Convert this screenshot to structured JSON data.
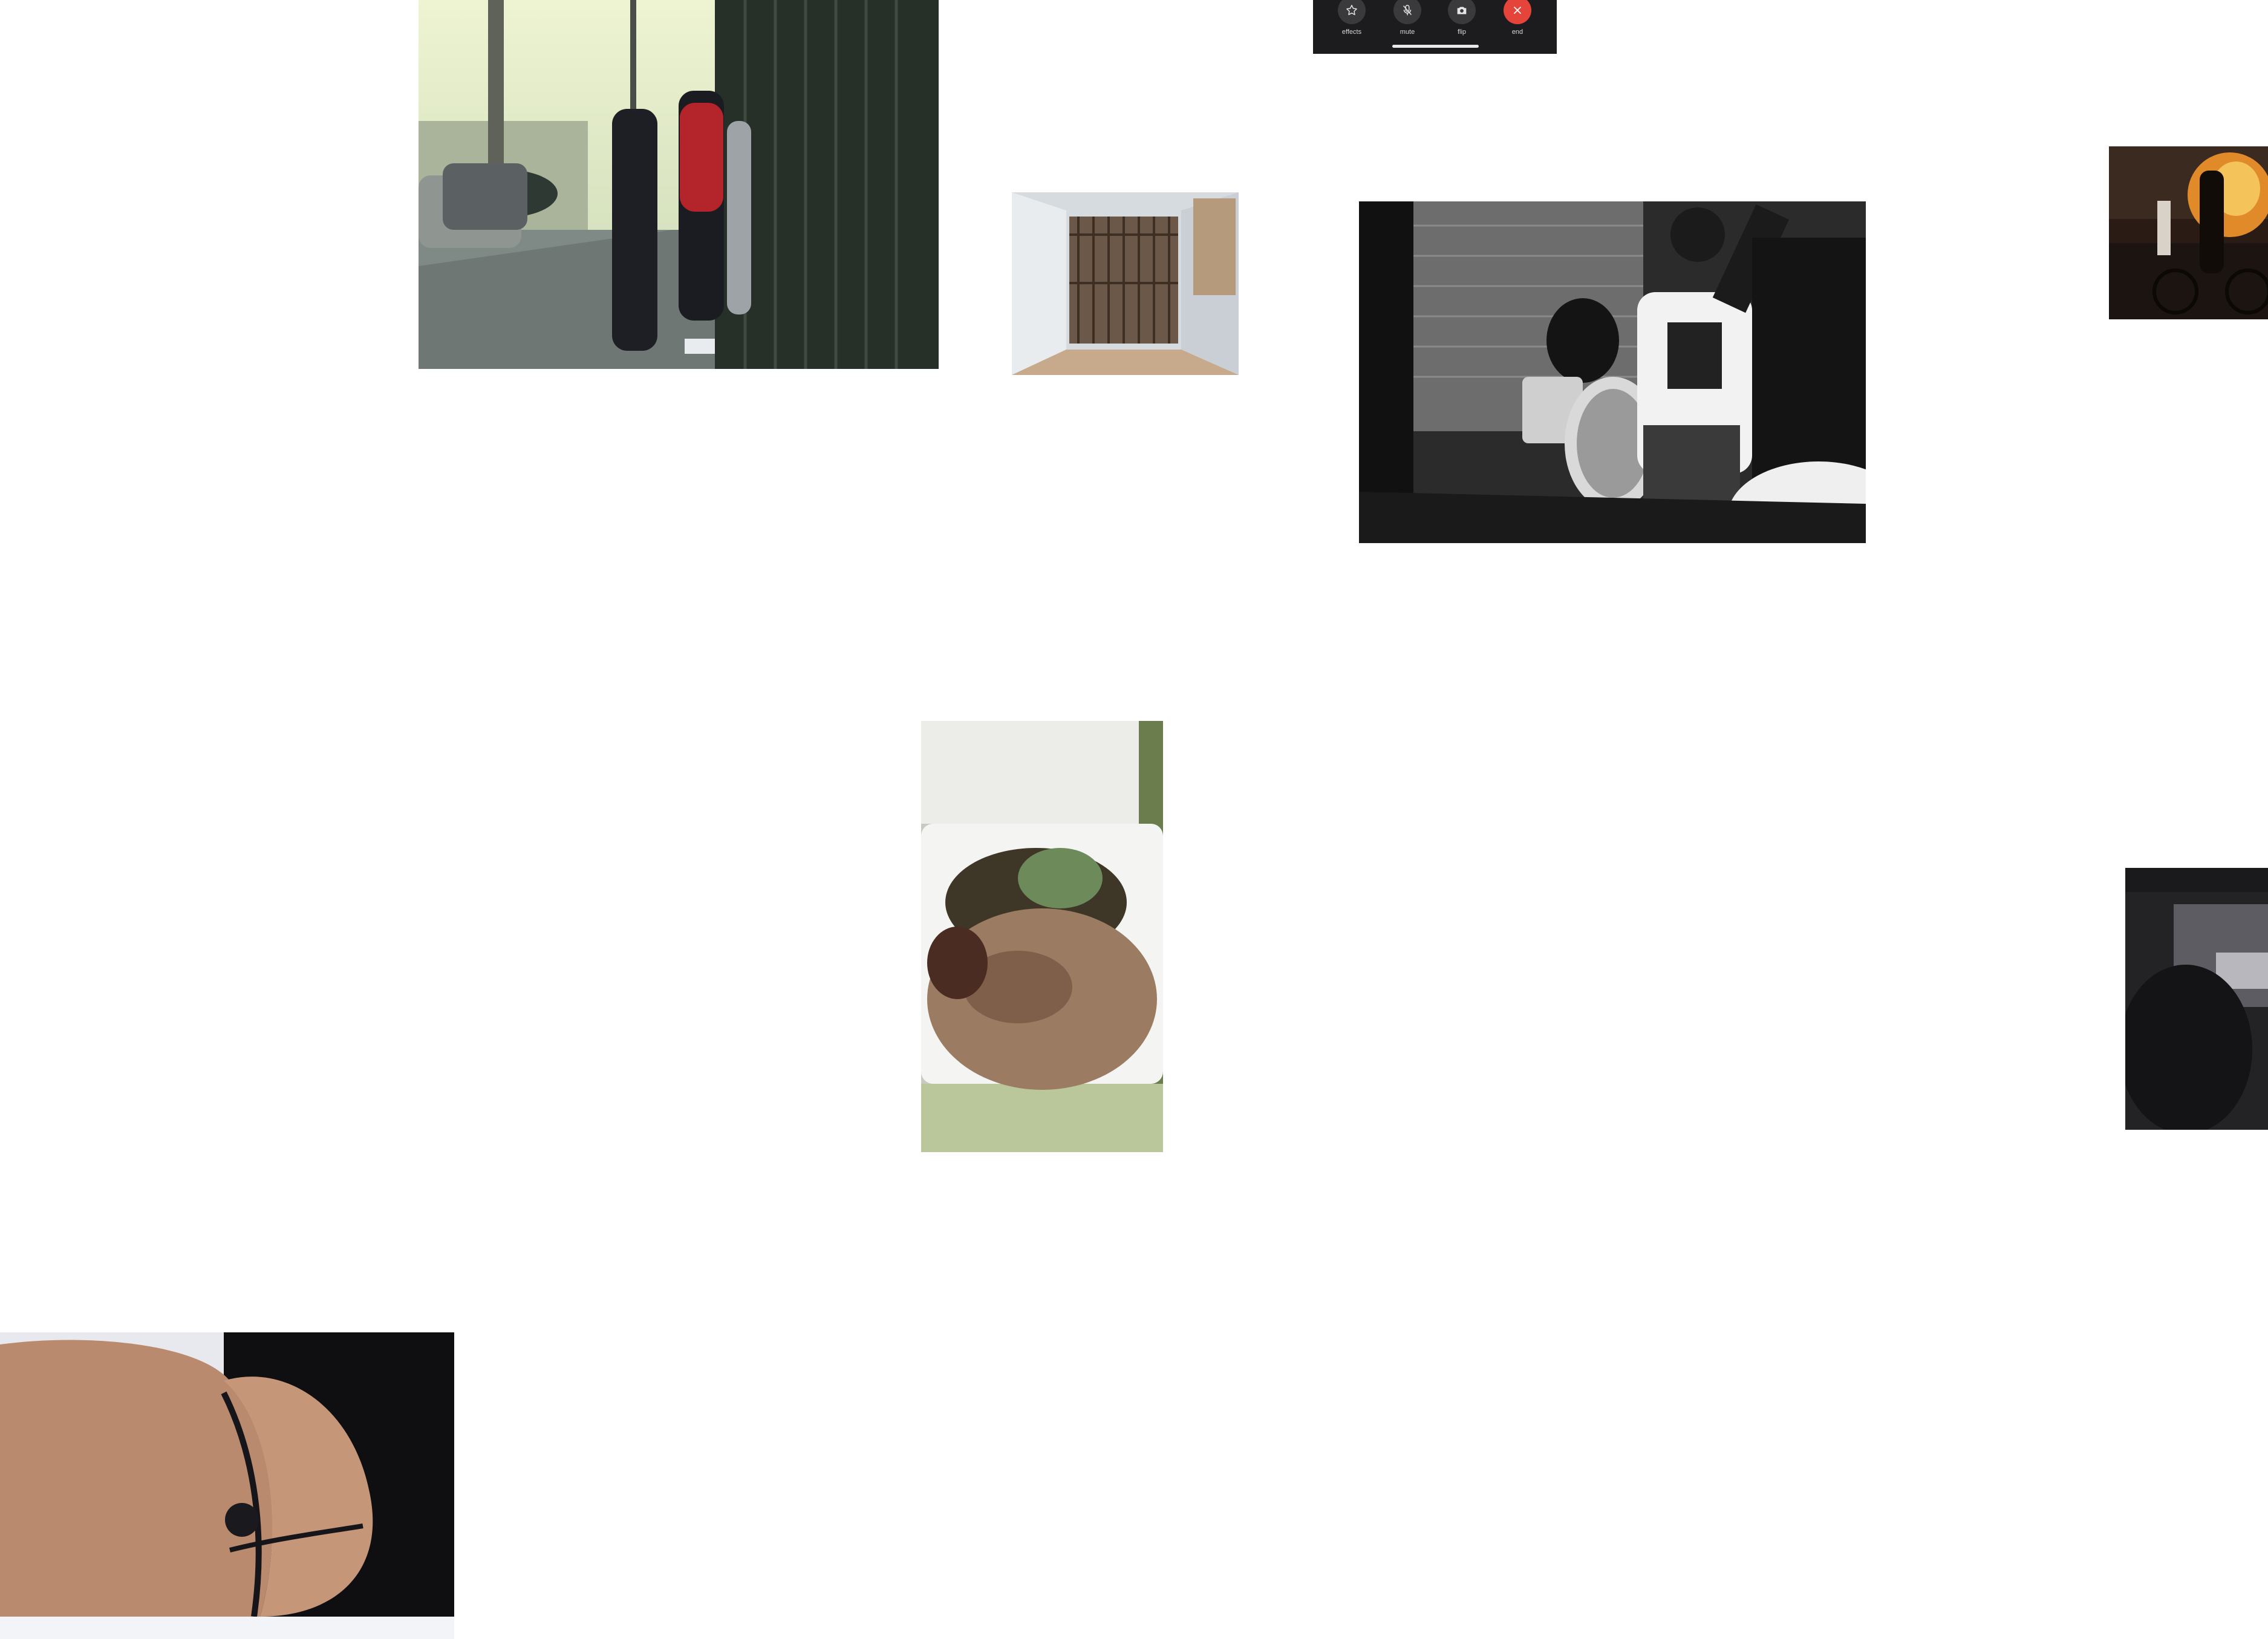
{
  "call_toolbar": {
    "buttons": [
      {
        "label": "effects",
        "icon": "star-icon"
      },
      {
        "label": "mute",
        "icon": "mic-slash-icon"
      },
      {
        "label": "flip",
        "icon": "camera-icon"
      },
      {
        "label": "end",
        "icon": "close-icon"
      }
    ],
    "colors": {
      "background": "#1c1c1e",
      "button": "#3a3a3c",
      "end_button": "#e5443b"
    }
  },
  "tiles": [
    {
      "name": "street-scene-photo",
      "kind": "photo"
    },
    {
      "name": "jail-hallway-photo",
      "kind": "photo"
    },
    {
      "name": "band-performance-photo",
      "kind": "photo"
    },
    {
      "name": "street-fire-bicycle-photo",
      "kind": "photo"
    },
    {
      "name": "takeout-food-photo",
      "kind": "photo"
    },
    {
      "name": "car-interior-night-photo",
      "kind": "photo"
    },
    {
      "name": "lower-back-photo",
      "kind": "photo"
    }
  ],
  "page": {
    "background": "#ffffff"
  }
}
